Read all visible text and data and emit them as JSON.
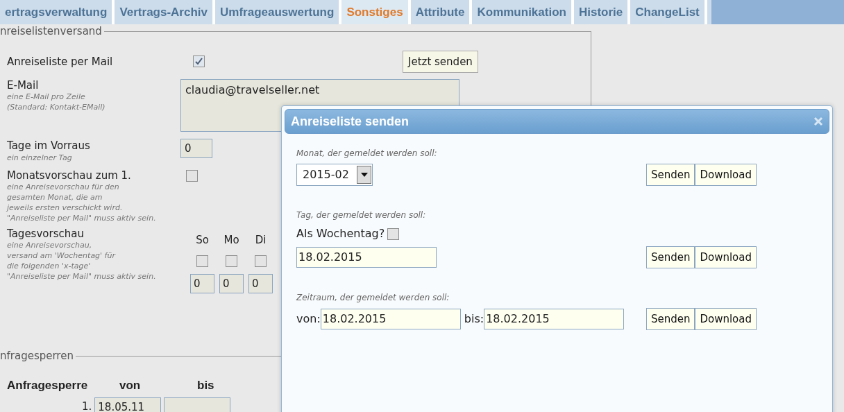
{
  "tabs": [
    {
      "label": "ertragsverwaltung",
      "selected": false
    },
    {
      "label": "Vertrags-Archiv",
      "selected": false
    },
    {
      "label": "Umfrageauswertung",
      "selected": false
    },
    {
      "label": "Sonstiges",
      "selected": true
    },
    {
      "label": "Attribute",
      "selected": false
    },
    {
      "label": "Kommunikation",
      "selected": false
    },
    {
      "label": "Historie",
      "selected": false
    },
    {
      "label": "ChangeList",
      "selected": false
    }
  ],
  "arrival_list": {
    "legend": "nreiselistenversand",
    "mail": {
      "label": "Anreiseliste per Mail",
      "checked": true
    },
    "send_now": "Jetzt senden",
    "email": {
      "label": "E-Mail",
      "hint_lines": [
        "eine E-Mail pro Zeile",
        "(Standard: Kontakt-EMail)"
      ],
      "value": "claudia@travelseller.net"
    },
    "days_ahead": {
      "label": "Tage im Vorraus",
      "hint_lines": [
        "ein einzelner Tag"
      ],
      "value": "0"
    },
    "month_preview": {
      "label": "Monatsvorschau zum 1.",
      "hint_lines": [
        "eine Anreisevorschau für den",
        "gesamten Monat, die am",
        "jeweils ersten verschickt wird.",
        "\"Anreiseliste per Mail\" muss aktiv sein."
      ],
      "checked": false
    },
    "day_preview": {
      "label": "Tagesvorschau",
      "hint_lines": [
        "eine Anreisevorschau,",
        "versand am 'Wochentag' für",
        "die folgenden 'x-tage'",
        "\"Anreiseliste per Mail\" muss aktiv sein."
      ],
      "days": [
        {
          "label": "So",
          "checked": false,
          "value": "0"
        },
        {
          "label": "Mo",
          "checked": false,
          "value": "0"
        },
        {
          "label": "Di",
          "checked": false,
          "value": "0"
        }
      ]
    }
  },
  "request_blocks": {
    "legend": "nfragesperren",
    "columns": [
      "Anfragesperre",
      "von",
      "bis"
    ],
    "rows": [
      {
        "number": "1.",
        "from": "18.05.11"
      }
    ]
  },
  "dialog": {
    "title": "Anreiseliste senden",
    "sections": [
      {
        "kind": "month",
        "caption": "Monat, der gemeldet werden soll:",
        "value": "2015-02",
        "buttons": [
          "Senden",
          "Download"
        ]
      },
      {
        "kind": "day",
        "caption": "Tag, der gemeldet werden soll:",
        "weekday": {
          "label": "Als Wochentag?",
          "checked": false
        },
        "value": "18.02.2015",
        "buttons": [
          "Senden",
          "Download"
        ]
      },
      {
        "kind": "range",
        "caption": "Zeitraum, der gemeldet werden soll:",
        "from_label": "von:",
        "from": "18.02.2015",
        "to_label": "bis:",
        "to": "18.02.2015",
        "buttons": [
          "Senden",
          "Download"
        ]
      }
    ]
  }
}
